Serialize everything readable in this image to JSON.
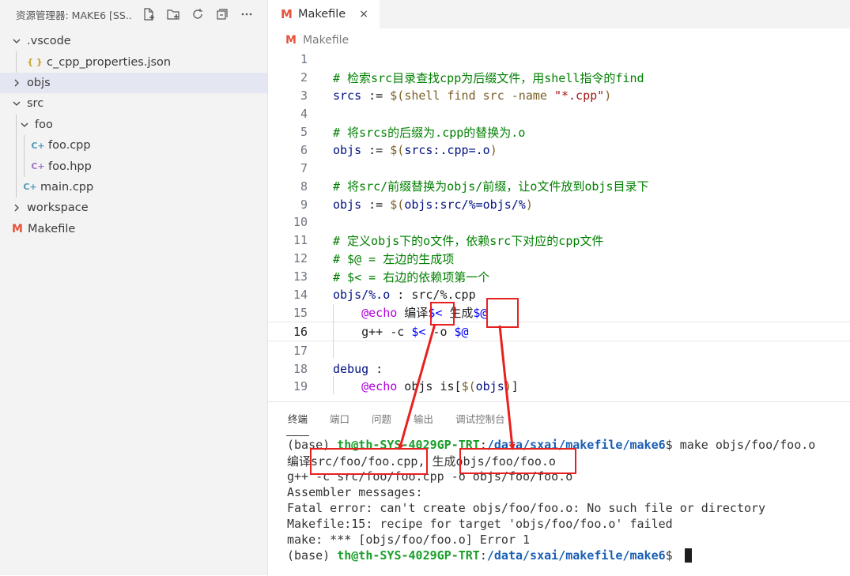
{
  "sidebar": {
    "title": "资源管理器: MAKE6 [SS...",
    "actions": [
      "new-file-icon",
      "new-folder-icon",
      "refresh-icon",
      "collapse-all-icon",
      "more-icon"
    ],
    "tree": [
      {
        "label": ".vscode",
        "type": "folder",
        "open": true
      },
      {
        "label": "c_cpp_properties.json",
        "type": "json-file"
      },
      {
        "label": "objs",
        "type": "folder",
        "open": false,
        "selected": true
      },
      {
        "label": "src",
        "type": "folder",
        "open": true
      },
      {
        "label": "foo",
        "type": "folder",
        "open": true
      },
      {
        "label": "foo.cpp",
        "type": "cpp-file"
      },
      {
        "label": "foo.hpp",
        "type": "hpp-file"
      },
      {
        "label": "main.cpp",
        "type": "cpp-file"
      },
      {
        "label": "workspace",
        "type": "folder",
        "open": false
      },
      {
        "label": "Makefile",
        "type": "makefile"
      }
    ]
  },
  "editor": {
    "tab": {
      "icon": "M",
      "label": "Makefile",
      "close": "×"
    },
    "breadcrumb": {
      "icon": "M",
      "label": "Makefile"
    },
    "active_line": 16,
    "lines": [
      {
        "n": "1",
        "segs": []
      },
      {
        "n": "2",
        "segs": [
          {
            "t": "# 检索src目录查找cpp为后缀文件，用shell指令的find",
            "c": "com"
          }
        ]
      },
      {
        "n": "3",
        "segs": [
          {
            "t": "srcs",
            "c": "var"
          },
          {
            "t": " := ",
            "c": "op"
          },
          {
            "t": "$(",
            "c": "dol"
          },
          {
            "t": "shell",
            "c": "fn"
          },
          {
            "t": " find src -name ",
            "c": "dol"
          },
          {
            "t": "\"*.cpp\"",
            "c": "str"
          },
          {
            "t": ")",
            "c": "dol"
          }
        ]
      },
      {
        "n": "4",
        "segs": []
      },
      {
        "n": "5",
        "segs": [
          {
            "t": "# 将srcs的后缀为.cpp的替换为.o",
            "c": "com"
          }
        ]
      },
      {
        "n": "6",
        "segs": [
          {
            "t": "objs",
            "c": "var"
          },
          {
            "t": " := ",
            "c": "op"
          },
          {
            "t": "$(",
            "c": "dol"
          },
          {
            "t": "srcs:.cpp=.o",
            "c": "var"
          },
          {
            "t": ")",
            "c": "dol"
          }
        ]
      },
      {
        "n": "7",
        "segs": []
      },
      {
        "n": "8",
        "segs": [
          {
            "t": "# 将src/前缀替换为objs/前缀，让o文件放到objs目录下",
            "c": "com"
          }
        ]
      },
      {
        "n": "9",
        "segs": [
          {
            "t": "objs",
            "c": "var"
          },
          {
            "t": " := ",
            "c": "op"
          },
          {
            "t": "$(",
            "c": "dol"
          },
          {
            "t": "objs:src/%=objs/%",
            "c": "var"
          },
          {
            "t": ")",
            "c": "dol"
          }
        ]
      },
      {
        "n": "10",
        "segs": []
      },
      {
        "n": "11",
        "segs": [
          {
            "t": "# 定义objs下的o文件，依赖src下对应的cpp文件",
            "c": "com"
          }
        ]
      },
      {
        "n": "12",
        "segs": [
          {
            "t": "# $@ = 左边的生成项",
            "c": "com"
          }
        ]
      },
      {
        "n": "13",
        "segs": [
          {
            "t": "# $< = 右边的依赖项第一个",
            "c": "com"
          }
        ]
      },
      {
        "n": "14",
        "segs": [
          {
            "t": "objs/%.o",
            "c": "var"
          },
          {
            "t": " : src/%.cpp",
            "c": "def"
          }
        ]
      },
      {
        "n": "15",
        "segs": [
          {
            "t": "    ",
            "c": "def"
          },
          {
            "t": "@echo",
            "c": "kw"
          },
          {
            "t": " 编译",
            "c": "def"
          },
          {
            "t": "$<",
            "c": "mac"
          },
          {
            "t": " 生成",
            "c": "def"
          },
          {
            "t": "$@",
            "c": "mac"
          }
        ]
      },
      {
        "n": "16",
        "segs": [
          {
            "t": "    g++ -c ",
            "c": "def"
          },
          {
            "t": "$<",
            "c": "mac"
          },
          {
            "t": " -o ",
            "c": "def"
          },
          {
            "t": "$@",
            "c": "mac"
          }
        ]
      },
      {
        "n": "17",
        "segs": []
      },
      {
        "n": "18",
        "segs": [
          {
            "t": "debug",
            "c": "var"
          },
          {
            "t": " :",
            "c": "def"
          }
        ]
      },
      {
        "n": "19",
        "segs": [
          {
            "t": "    ",
            "c": "def"
          },
          {
            "t": "@echo",
            "c": "kw"
          },
          {
            "t": " objs is[",
            "c": "def"
          },
          {
            "t": "$(",
            "c": "dol"
          },
          {
            "t": "objs",
            "c": "var"
          },
          {
            "t": ")",
            "c": "dol"
          },
          {
            "t": "]",
            "c": "def"
          }
        ]
      }
    ]
  },
  "panel": {
    "tabs": [
      "终端",
      "端口",
      "问题",
      "输出",
      "调试控制台"
    ],
    "active_tab": 0,
    "terminal": [
      {
        "prefix": "(base) ",
        "user": "th@th-SYS-4029GP-TRT",
        "sep": ":",
        "path": "/data/sxai/makefile/make6",
        "rest": "$ make objs/foo/foo.o"
      },
      {
        "text": "编译src/foo/foo.cpp, 生成objs/foo/foo.o"
      },
      {
        "text": "g++ -c src/foo/foo.cpp -o objs/foo/foo.o"
      },
      {
        "text": "Assembler messages:"
      },
      {
        "text": "Fatal error: can't create objs/foo/foo.o: No such file or directory"
      },
      {
        "text": "Makefile:15: recipe for target 'objs/foo/foo.o' failed"
      },
      {
        "text": "make: *** [objs/foo/foo.o] Error 1"
      },
      {
        "prefix": "(base) ",
        "user": "th@th-SYS-4029GP-TRT",
        "sep": ":",
        "path": "/data/sxai/makefile/make6",
        "rest": "$ ",
        "cursor": true
      }
    ]
  },
  "colors": {
    "annotation": "#e82020",
    "makefile_icon": "#e5533c",
    "cpp_icon": "#519aba",
    "hpp_icon": "#a074c4"
  }
}
